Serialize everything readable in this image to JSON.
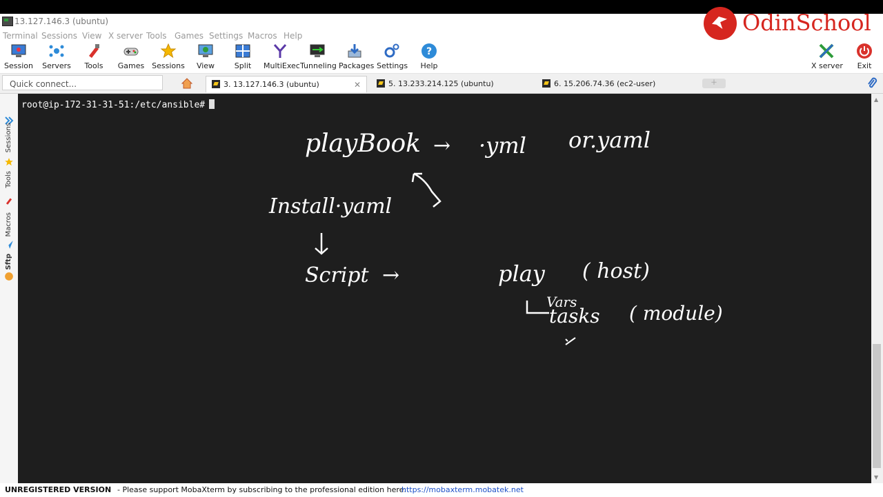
{
  "window": {
    "title": "13.127.146.3 (ubuntu)"
  },
  "menu": [
    "Terminal",
    "Sessions",
    "View",
    "X server",
    "Tools",
    "Games",
    "Settings",
    "Macros",
    "Help"
  ],
  "toolbar": {
    "items": [
      "Session",
      "Servers",
      "Tools",
      "Games",
      "Sessions",
      "View",
      "Split",
      "MultiExec",
      "Tunneling",
      "Packages",
      "Settings",
      "Help"
    ],
    "right_items": [
      "X server",
      "Exit"
    ]
  },
  "quick_connect": {
    "placeholder": "Quick connect..."
  },
  "tabs": [
    {
      "label": "3. 13.127.146.3 (ubuntu)",
      "active": true
    },
    {
      "label": "5. 13.233.214.125 (ubuntu)",
      "active": false
    },
    {
      "label": "6. 15.206.74.36 (ec2-user)",
      "active": false
    }
  ],
  "sidebar": [
    "Sessions",
    "Tools",
    "Macros",
    "Sftp"
  ],
  "terminal": {
    "prompt": "root@ip-172-31-31-51:/etc/ansible#"
  },
  "annotations": {
    "playbook": "playBook",
    "arrow1": "→",
    "ext1": "·yml",
    "or_yaml": "or.yaml",
    "install": "Install·yaml",
    "script": "Script",
    "arrow2": "→",
    "play": "play",
    "host": "( host)",
    "vars": "Vars",
    "tasks": "tasks",
    "module": "( module)"
  },
  "status": {
    "label": "UNREGISTERED VERSION",
    "message": "-  Please support MobaXterm by subscribing to the professional edition here:",
    "url": "https://mobaxterm.mobatek.net"
  },
  "brand": {
    "name": "OdinSchool",
    "color": "#d6261f"
  }
}
